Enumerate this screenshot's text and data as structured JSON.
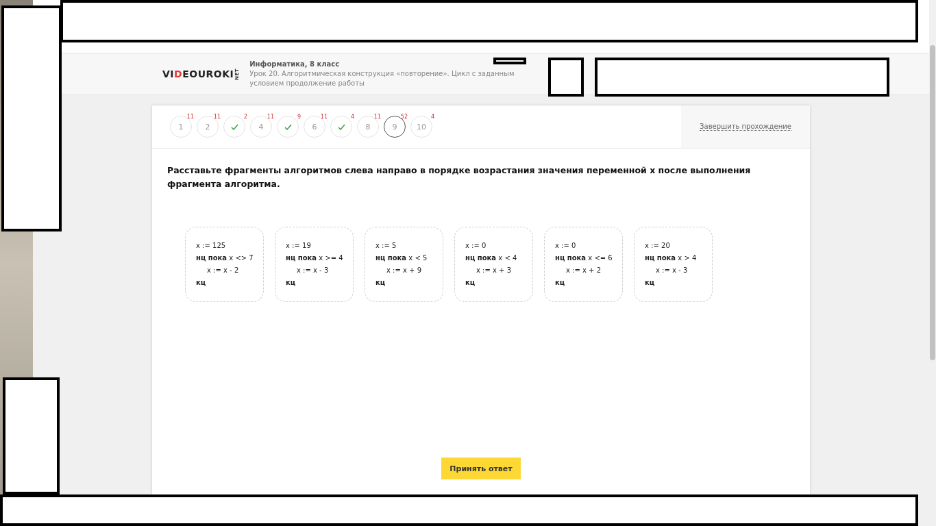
{
  "header": {
    "logo": {
      "before": "VI",
      "accent": "D",
      "after": "EOUROKI",
      "suffix": "NET"
    },
    "subject": "Информатика, 8 класс",
    "lesson": "Урок 20. Алгоритмическая конструкция «повторение». Цикл с заданным условием продолжение работы"
  },
  "steps": [
    {
      "label": "1",
      "badge": "11",
      "done": false,
      "selected": false
    },
    {
      "label": "2",
      "badge": "11",
      "done": false,
      "selected": false
    },
    {
      "badge": "2",
      "done": true,
      "selected": false
    },
    {
      "label": "4",
      "badge": "11",
      "done": false,
      "selected": false
    },
    {
      "badge": "9",
      "done": true,
      "selected": false
    },
    {
      "label": "6",
      "badge": "11",
      "done": false,
      "selected": false
    },
    {
      "badge": "4",
      "done": true,
      "selected": false
    },
    {
      "label": "8",
      "badge": "11",
      "done": false,
      "selected": false
    },
    {
      "label": "9",
      "badge": "52",
      "done": false,
      "selected": true
    },
    {
      "label": "10",
      "badge": "4",
      "done": false,
      "selected": false
    }
  ],
  "finish_link": "Завершить прохождение",
  "question": "Расставьте фрагменты алгоритмов слева направо в порядке возрастания значения переменной x после выполнения фрагмента алгоритма.",
  "fragments": [
    {
      "init": "x := 125",
      "loop": "**нц пока** x <> 7",
      "body": "x := x - 2",
      "end": "кц"
    },
    {
      "init": "x := 19",
      "loop": "**нц пока** x >= 4",
      "body": "x := x - 3",
      "end": "кц"
    },
    {
      "init": "x := 5",
      "loop": "**нц пока** x < 5",
      "body": "x := x + 9",
      "end": "кц"
    },
    {
      "init": "x := 0",
      "loop": "**нц пока** x < 4",
      "body": "x := x + 3",
      "end": "кц"
    },
    {
      "init": "x := 0",
      "loop": "**нц пока** x <= 6",
      "body": "x := x + 2",
      "end": "кц"
    },
    {
      "init": "x := 20",
      "loop": "**нц пока** x > 4",
      "body": "x := x - 3",
      "end": "кц"
    }
  ],
  "submit_button": "Принять ответ"
}
